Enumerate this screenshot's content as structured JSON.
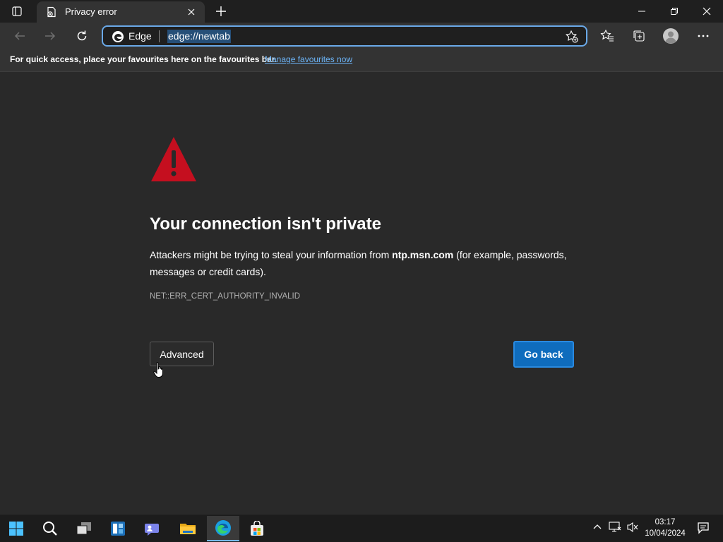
{
  "window": {
    "tab_title": "Privacy error",
    "tab_favicon": "page-error-icon"
  },
  "toolbar": {
    "site_label": "Edge",
    "url": "edge://newtab"
  },
  "favourites_bar": {
    "message": "For quick access, place your favourites here on the favourites bar.",
    "link": "Manage favourites now"
  },
  "error_page": {
    "heading": "Your connection isn't private",
    "description_prefix": "Attackers might be trying to steal your information from ",
    "host": "ntp.msn.com",
    "description_suffix": " (for example, passwords, messages or credit cards).",
    "error_code": "NET::ERR_CERT_AUTHORITY_INVALID",
    "advanced_label": "Advanced",
    "go_back_label": "Go back"
  },
  "taskbar": {
    "time": "03:17",
    "date": "10/04/2024",
    "apps": [
      "start-icon",
      "search-icon",
      "task-view-icon",
      "widgets-icon",
      "chat-icon",
      "file-explorer-icon",
      "edge-icon",
      "store-icon"
    ]
  },
  "colors": {
    "accent": "#0f6cbd",
    "warning": "#c50f1f",
    "link": "#6cb4f7"
  }
}
